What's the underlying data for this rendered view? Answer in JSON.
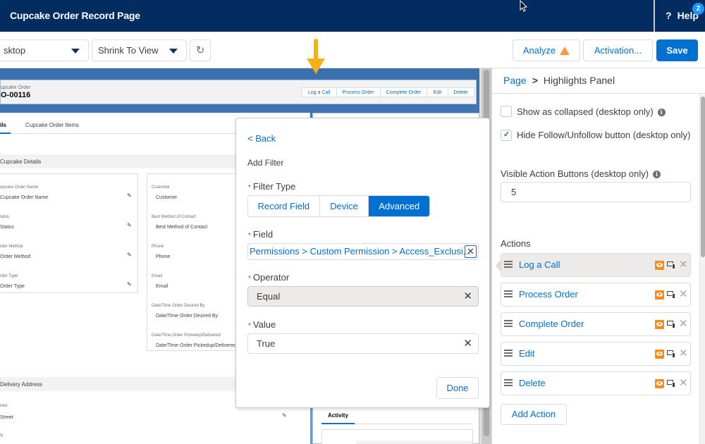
{
  "header": {
    "app_title": "Cupcake Order Record Page",
    "help_label": "Help",
    "help_icon": "question-icon",
    "help_badge_count": "2"
  },
  "toolbar": {
    "form_factor_select": "sktop",
    "view_mode_select": "Shrink To View",
    "refresh_icon": "refresh-icon",
    "analyze_label": "Analyze",
    "analyze_icon": "warning-icon",
    "activation_label": "Activation...",
    "save_label": "Save"
  },
  "canvas": {
    "highlights": {
      "object_label": "upcake Order",
      "record_name": "O-00116",
      "actions": [
        "Log a Call",
        "Process Order",
        "Complete Order",
        "Edit",
        "Delete"
      ]
    },
    "tabs": [
      "ils",
      "Cupcake Order Items"
    ],
    "sections": {
      "cupcake_details": "Cupcake Details",
      "delivery_address": "Delivery Address"
    },
    "left_fields": [
      {
        "label": "upcake Order Name",
        "value": "Cupcake Order Name"
      },
      {
        "label": "tatus",
        "value": "Status"
      },
      {
        "label": "rder Method",
        "value": "Order Method"
      },
      {
        "label": "rder Type",
        "value": "Order Type"
      }
    ],
    "right_fields": [
      {
        "label": "Customer",
        "value": "Customer"
      },
      {
        "label": "Best Method of Contact",
        "value": "Best Method of Contact"
      },
      {
        "label": "Phone",
        "value": "Phone"
      },
      {
        "label": "Email",
        "value": "Email"
      },
      {
        "label": "Date/Time Order Desired By",
        "value": "Date/Time Order Desired By"
      },
      {
        "label": "Date/Time Order Pickedup/Delivered",
        "value": "Date/Time Order Pickedup/Delivered"
      }
    ],
    "address_fields": [
      {
        "label": "reet",
        "value": "Street"
      },
      {
        "label": "ty",
        "value": ""
      }
    ],
    "activity_tab": "Activity"
  },
  "filter_popover": {
    "back_label": "< Back",
    "title": "Add Filter",
    "filter_type_label": "Filter Type",
    "filter_types": [
      "Record Field",
      "Device",
      "Advanced"
    ],
    "selected_filter_type": "Advanced",
    "field_label": "Field",
    "field_value": "Permissions > Custom Permission > Access_Exclusi...",
    "operator_label": "Operator",
    "operator_value": "Equal",
    "value_label": "Value",
    "value_value": "True",
    "done_label": "Done",
    "required_marker": "*"
  },
  "properties": {
    "breadcrumb": {
      "root": "Page",
      "separator": ">",
      "current": "Highlights Panel"
    },
    "show_collapsed": {
      "label": "Show as collapsed (desktop only)",
      "checked": false
    },
    "hide_follow": {
      "label": "Hide Follow/Unfollow button (desktop only)",
      "checked": true
    },
    "visible_action_buttons": {
      "label": "Visible Action Buttons (desktop only)",
      "value": "5"
    },
    "actions_label": "Actions",
    "actions": [
      {
        "label": "Log a Call",
        "selected": true
      },
      {
        "label": "Process Order",
        "selected": false
      },
      {
        "label": "Complete Order",
        "selected": false
      },
      {
        "label": "Edit",
        "selected": false
      },
      {
        "label": "Delete",
        "selected": false
      }
    ],
    "add_action_label": "Add Action"
  },
  "colors": {
    "header_bg": "#032d60",
    "brand_blue": "#0070d2",
    "annotation_arrow": "#f5b013",
    "visibility_orange": "#ff8a1b"
  }
}
